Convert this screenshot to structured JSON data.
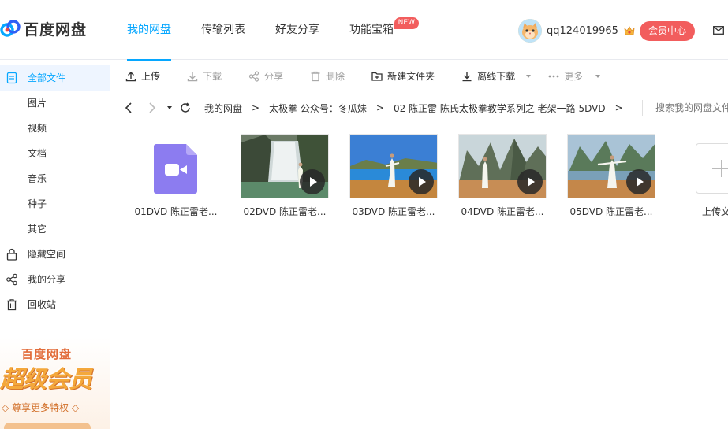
{
  "header": {
    "logo_text": "百度网盘",
    "nav": [
      {
        "label": "我的网盘",
        "active": true
      },
      {
        "label": "传输列表",
        "active": false
      },
      {
        "label": "好友分享",
        "active": false
      },
      {
        "label": "功能宝箱",
        "active": false,
        "badge": "NEW"
      }
    ],
    "username": "qq124019965",
    "vip_button": "会员中心",
    "accent": "#06a7ff",
    "vip_color": "#f25d5d"
  },
  "sidebar": {
    "items": [
      {
        "label": "全部文件",
        "icon": "file-list-icon",
        "active": true
      },
      {
        "label": "图片"
      },
      {
        "label": "视频"
      },
      {
        "label": "文档"
      },
      {
        "label": "音乐"
      },
      {
        "label": "种子"
      },
      {
        "label": "其它"
      },
      {
        "label": "隐藏空间",
        "icon": "lock-icon"
      },
      {
        "label": "我的分享",
        "icon": "share-icon"
      },
      {
        "label": "回收站",
        "icon": "trash-icon"
      }
    ],
    "promo": {
      "title": "百度网盘",
      "headline": "超级会员",
      "subtitle": "◇ 尊享更多特权 ◇"
    }
  },
  "toolbar": {
    "upload": "上传",
    "download": "下载",
    "share": "分享",
    "delete": "删除",
    "new_folder": "新建文件夹",
    "offline_download": "离线下载",
    "more": "更多"
  },
  "path": {
    "crumbs": [
      "我的网盘",
      "太极拳 公众号：冬瓜妹",
      "02 陈正雷 陈氏太极拳教学系列之 老架一路 5DVD"
    ],
    "search_placeholder": "搜索我的网盘文件"
  },
  "files": [
    {
      "name": "01DVD 陈正雷老...",
      "type": "video-placeholder"
    },
    {
      "name": "02DVD 陈正雷老...",
      "type": "video-thumb"
    },
    {
      "name": "03DVD 陈正雷老...",
      "type": "video-thumb"
    },
    {
      "name": "04DVD 陈正雷老...",
      "type": "video-thumb"
    },
    {
      "name": "05DVD 陈正雷老...",
      "type": "video-thumb"
    }
  ],
  "upload_tile_label": "上传文件"
}
